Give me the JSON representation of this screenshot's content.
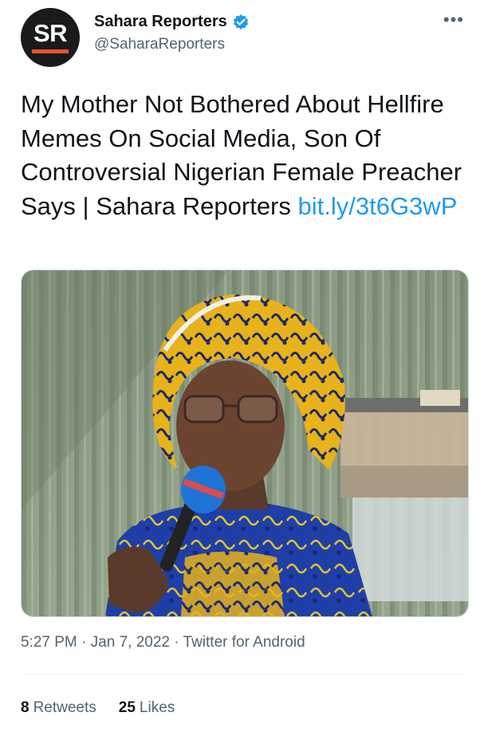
{
  "account": {
    "avatar_text": "SR",
    "display_name": "Sahara Reporters",
    "handle": "@SaharaReporters",
    "verified_icon": "verified-badge-icon",
    "more_icon": "more-options-icon"
  },
  "tweet": {
    "text": "My Mother Not Bothered About Hellfire Memes On Social Media, Son Of Controversial Nigerian Female Preacher Says | Sahara Reporters ",
    "link": "bit.ly/3t6G3wP",
    "media_alt": "Woman in yellow and blue headwrap and blue patterned dress speaking into a microphone"
  },
  "meta": {
    "time": "5:27 PM",
    "separator": "·",
    "date": "Jan 7, 2022",
    "source": "Twitter for Android"
  },
  "stats": {
    "retweets_count": "8",
    "retweets_label": "Retweets",
    "likes_count": "25",
    "likes_label": "Likes"
  },
  "colors": {
    "link": "#1d9bf0",
    "secondary_text": "#536471",
    "avatar_bar": "#e8542d"
  }
}
